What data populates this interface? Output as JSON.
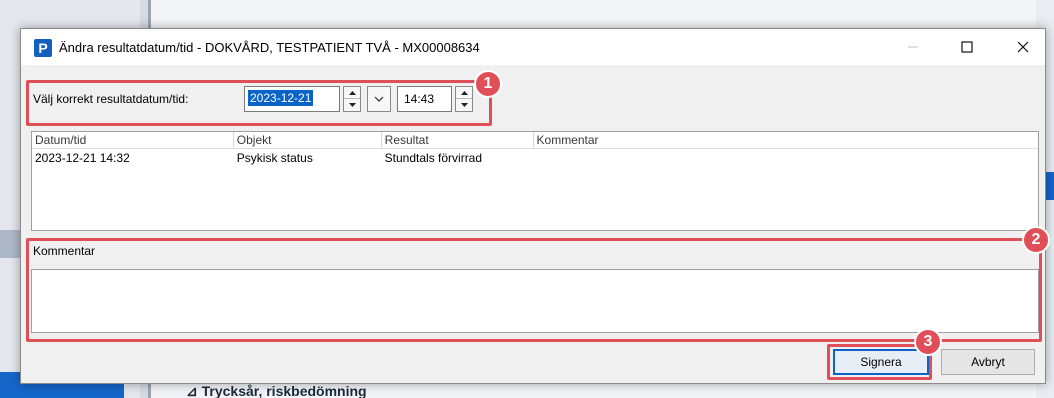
{
  "window": {
    "app_icon_letter": "P",
    "title": "Ändra resultatdatum/tid - DOKVÅRD, TESTPATIENT TVÅ - MX00008634"
  },
  "date_row": {
    "label": "Välj korrekt resultatdatum/tid:",
    "date_value": "2023-12-21",
    "time_value": "14:43"
  },
  "results_table": {
    "columns": [
      "Datum/tid",
      "Objekt",
      "Resultat",
      "Kommentar"
    ],
    "rows": [
      [
        "2023-12-21 14:32",
        "Psykisk status",
        "Stundtals förvirrad",
        ""
      ]
    ]
  },
  "comment": {
    "label": "Kommentar",
    "value": ""
  },
  "buttons": {
    "sign": "Signera",
    "cancel": "Avbryt"
  },
  "annotations": {
    "markers": [
      "1",
      "2",
      "3"
    ],
    "color": "#e04e57"
  },
  "background_app": {
    "tree_item": "⊿ Trycksår, riskbedömning"
  }
}
